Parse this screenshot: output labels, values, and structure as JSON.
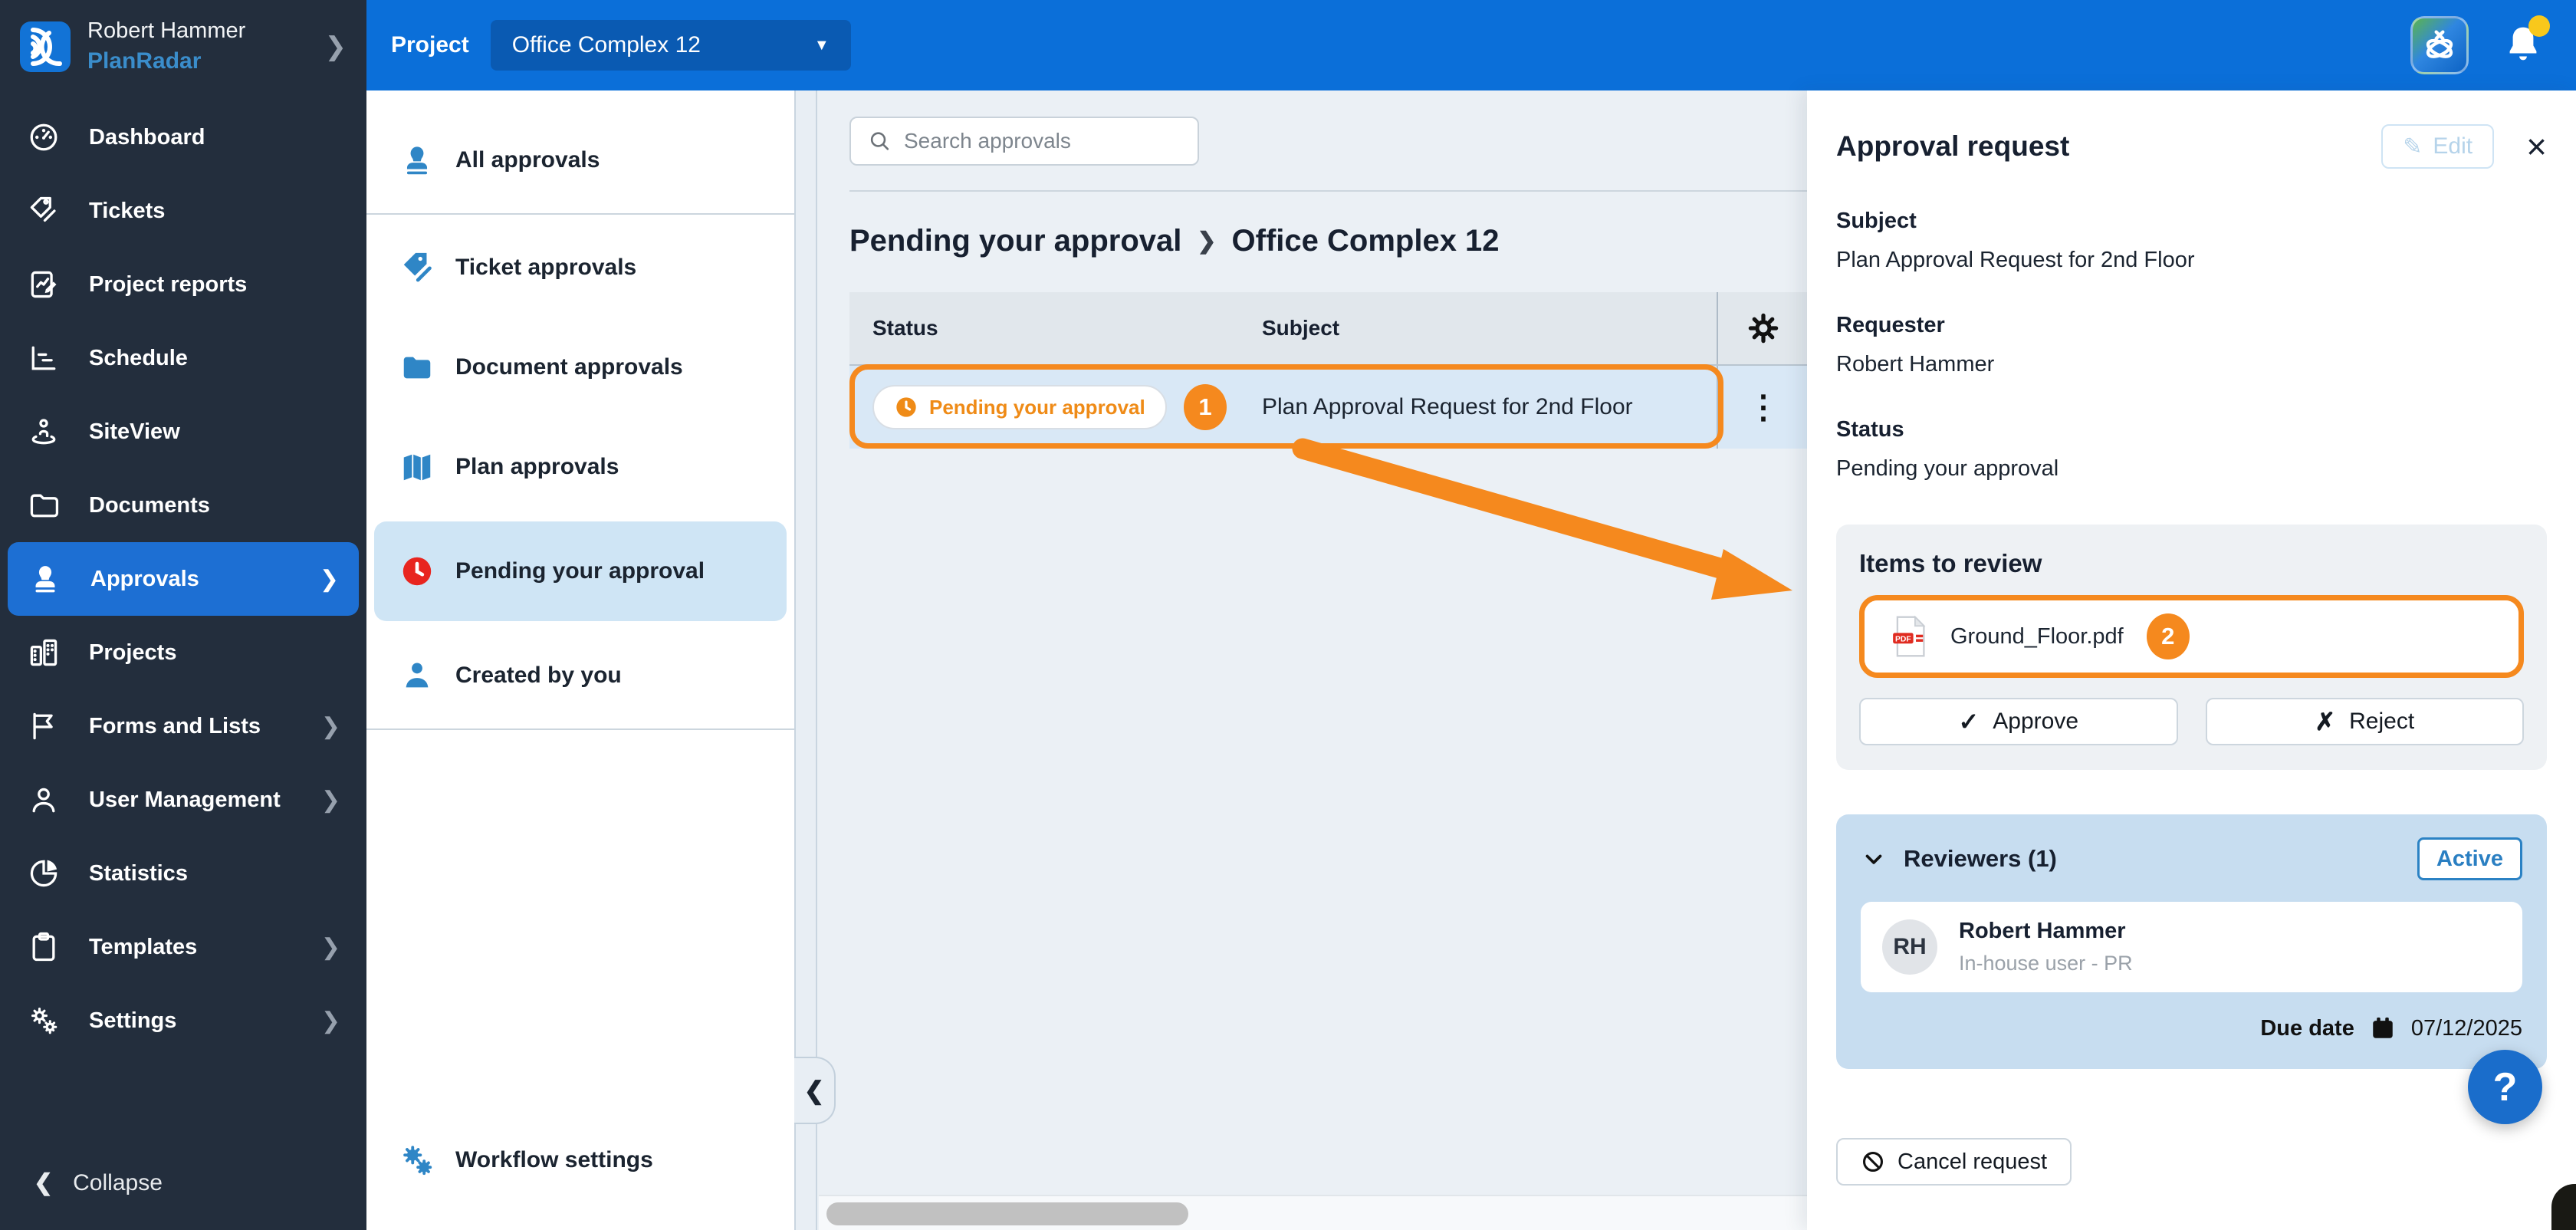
{
  "icons": {
    "chevron_right": "❯",
    "chevron_left": "❮",
    "kebab": "⋮",
    "close": "×",
    "caret_down": "▼",
    "check": "✓",
    "cross": "✗",
    "help": "?",
    "pencil": "✎",
    "crumb_sep": "❯"
  },
  "colors": {
    "topbar_blue": "#0b6fd9",
    "sidebar_dark": "#232e3d",
    "brand_blue": "#2f86c6",
    "active_blue": "#1d6fd3",
    "annotation_orange": "#f5891e",
    "pending_red": "#e8251f",
    "row_blue": "#d9e8f6",
    "content_gray": "#ebf0f5"
  },
  "user": {
    "name": "Robert Hammer",
    "brand": "PlanRadar"
  },
  "topbar": {
    "project_label": "Project",
    "project_value": "Office Complex 12"
  },
  "sidebar": {
    "items": [
      {
        "label": "Dashboard"
      },
      {
        "label": "Tickets"
      },
      {
        "label": "Project reports"
      },
      {
        "label": "Schedule"
      },
      {
        "label": "SiteView"
      },
      {
        "label": "Documents"
      },
      {
        "label": "Approvals"
      },
      {
        "label": "Projects"
      },
      {
        "label": "Forms and Lists"
      },
      {
        "label": "User Management"
      },
      {
        "label": "Statistics"
      },
      {
        "label": "Templates"
      },
      {
        "label": "Settings"
      }
    ],
    "collapse_label": "Collapse"
  },
  "categories": {
    "items": [
      {
        "label": "All approvals"
      },
      {
        "label": "Ticket approvals"
      },
      {
        "label": "Document approvals"
      },
      {
        "label": "Plan approvals"
      },
      {
        "label": "Pending your approval"
      },
      {
        "label": "Created by you"
      }
    ],
    "workflow_label": "Workflow settings"
  },
  "list": {
    "search_placeholder": "Search approvals",
    "breadcrumb": {
      "parent": "Pending your approval",
      "current": "Office Complex 12"
    },
    "columns": {
      "status": "Status",
      "subject": "Subject"
    },
    "row": {
      "status": "Pending your approval",
      "annotation_badge": "1",
      "subject": "Plan Approval Request for 2nd Floor"
    }
  },
  "detail": {
    "title": "Approval request",
    "edit_label": "Edit",
    "subject_label": "Subject",
    "subject_value": "Plan Approval Request for 2nd Floor",
    "requester_label": "Requester",
    "requester_value": "Robert Hammer",
    "status_label": "Status",
    "status_value": "Pending your approval",
    "items": {
      "title": "Items to review",
      "file_name": "Ground_Floor.pdf",
      "file_badge": "2",
      "approve_label": "Approve",
      "reject_label": "Reject"
    },
    "reviewers": {
      "title": "Reviewers (1)",
      "status_badge": "Active",
      "initials": "RH",
      "name": "Robert Hammer",
      "subtitle": "In-house user - PR",
      "due_date_label": "Due date",
      "due_date": "07/12/2025"
    },
    "cancel_label": "Cancel request"
  }
}
